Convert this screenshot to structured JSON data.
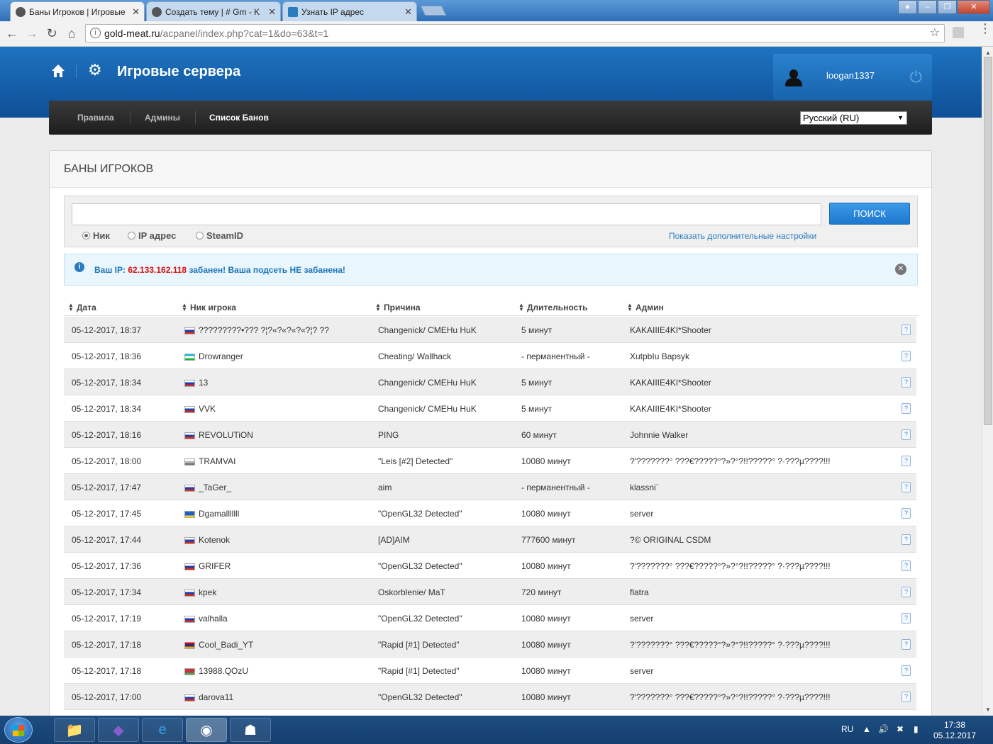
{
  "browser": {
    "tabs": [
      {
        "title": "Баны Игроков | Игровые",
        "active": true
      },
      {
        "title": "Создать тему | # Gm - K",
        "active": false
      },
      {
        "title": "Узнать IP адрес",
        "active": false
      }
    ],
    "url_host": "gold-meat.ru",
    "url_path": "/acpanel/index.php?cat=1&do=63&t=1"
  },
  "header": {
    "site_title": "Игровые сервера",
    "username": "loogan1337"
  },
  "nav": {
    "items": [
      "Правила",
      "Админы",
      "Список Банов"
    ],
    "active_index": 2,
    "language": "Русский (RU)"
  },
  "panel": {
    "title": "БАНЫ ИГРОКОВ",
    "search_button": "ПОИСК",
    "search_value": "",
    "radio_options": [
      "Ник",
      "IP адрес",
      "SteamID"
    ],
    "radio_selected": 0,
    "more_settings_link": "Показать дополнительные настройки"
  },
  "alert": {
    "prefix": "Ваш IP: ",
    "ip": "62.133.162.118",
    "suffix": " забанен! Ваша подсеть НЕ забанена!"
  },
  "table": {
    "columns": [
      "Дата",
      "Ник игрока",
      "Причина",
      "Длительность",
      "Админ"
    ],
    "rows": [
      {
        "date": "05-12-2017, 18:37",
        "flag": "ru",
        "nick": "?????????•??? ?¦?«?«?«?«?¦? ??",
        "reason": "Changenick/ CMEHu HuK",
        "duration": "5 минут",
        "admin": "KAKAIIIE4KI*Shooter"
      },
      {
        "date": "05-12-2017, 18:36",
        "flag": "uz",
        "nick": "Drowranger",
        "reason": "Cheating/ Wallhack",
        "duration": "- перманентный -",
        "admin": "XutpbIu Bapsyk"
      },
      {
        "date": "05-12-2017, 18:34",
        "flag": "ru",
        "nick": "13",
        "reason": "Changenick/ CMEHu HuK",
        "duration": "5 минут",
        "admin": "KAKAIIIE4KI*Shooter"
      },
      {
        "date": "05-12-2017, 18:34",
        "flag": "ru",
        "nick": "VVK",
        "reason": "Changenick/ CMEHu HuK",
        "duration": "5 минут",
        "admin": "KAKAIIIE4KI*Shooter"
      },
      {
        "date": "05-12-2017, 18:16",
        "flag": "ru",
        "nick": "REVOLUTiON",
        "reason": "PING",
        "duration": "60 минут",
        "admin": "Johnnie Walker"
      },
      {
        "date": "05-12-2017, 18:00",
        "flag": "unknown",
        "nick": "TRAMVAI",
        "reason": "\"Leis [#2] Detected\"",
        "duration": "10080 минут",
        "admin": "?'???????° ???€?????°?»?°?!!?????° ?·???µ????!!!"
      },
      {
        "date": "05-12-2017, 17:47",
        "flag": "ru",
        "nick": "_TaGer_",
        "reason": "aim",
        "duration": "- перманентный -",
        "admin": "klassni`"
      },
      {
        "date": "05-12-2017, 17:45",
        "flag": "ua",
        "nick": "Dgamalllllll",
        "reason": "\"OpenGL32 Detected\"",
        "duration": "10080 минут",
        "admin": "server"
      },
      {
        "date": "05-12-2017, 17:44",
        "flag": "ru",
        "nick": "Kotenok",
        "reason": "[AD]AIM",
        "duration": "777600 минут",
        "admin": "?© ORIGINAL CSDM"
      },
      {
        "date": "05-12-2017, 17:36",
        "flag": "ru",
        "nick": "GRIFER",
        "reason": "\"OpenGL32 Detected\"",
        "duration": "10080 минут",
        "admin": "?'???????° ???€?????°?»?°?!!?????° ?·???µ????!!!"
      },
      {
        "date": "05-12-2017, 17:34",
        "flag": "ru",
        "nick": "kpek",
        "reason": "Oskorblenie/ MaT",
        "duration": "720 минут",
        "admin": "flatra"
      },
      {
        "date": "05-12-2017, 17:19",
        "flag": "ru",
        "nick": "valhalla",
        "reason": "\"OpenGL32 Detected\"",
        "duration": "10080 минут",
        "admin": "server"
      },
      {
        "date": "05-12-2017, 17:18",
        "flag": "am",
        "nick": "Cool_Badi_YT",
        "reason": "\"Rapid [#1] Detected\"",
        "duration": "10080 минут",
        "admin": "?'???????° ???€?????°?»?°?!!?????° ?·???µ????!!!"
      },
      {
        "date": "05-12-2017, 17:18",
        "flag": "by",
        "nick": "13988.QOzU",
        "reason": "\"Rapid [#1] Detected\"",
        "duration": "10080 минут",
        "admin": "server"
      },
      {
        "date": "05-12-2017, 17:00",
        "flag": "ru",
        "nick": "darova11",
        "reason": "\"OpenGL32 Detected\"",
        "duration": "10080 минут",
        "admin": "?'???????° ???€?????°?»?°?!!?????° ?·???µ????!!!"
      }
    ]
  },
  "flags": {
    "ru": [
      "#ffffff",
      "#1c3fb0",
      "#d52b1e"
    ],
    "uz": [
      "#1eb5e6",
      "#ffffff",
      "#1eb53a"
    ],
    "ua": [
      "#1c5fd0",
      "#1c5fd0",
      "#ffd500"
    ],
    "am": [
      "#d90012",
      "#0033a0",
      "#f2a800"
    ],
    "by": [
      "#c8313e",
      "#c8313e",
      "#4aa657"
    ],
    "unknown": [
      "#ffffff",
      "#bbbbbb",
      "#777777"
    ]
  },
  "taskbar": {
    "lang": "RU",
    "time": "17:38",
    "date": "05.12.2017"
  },
  "icons": {
    "home": "home-icon",
    "gear": "gear-icon",
    "power": "power-icon",
    "info": "info-icon",
    "close": "close-icon",
    "details": "details-icon"
  }
}
